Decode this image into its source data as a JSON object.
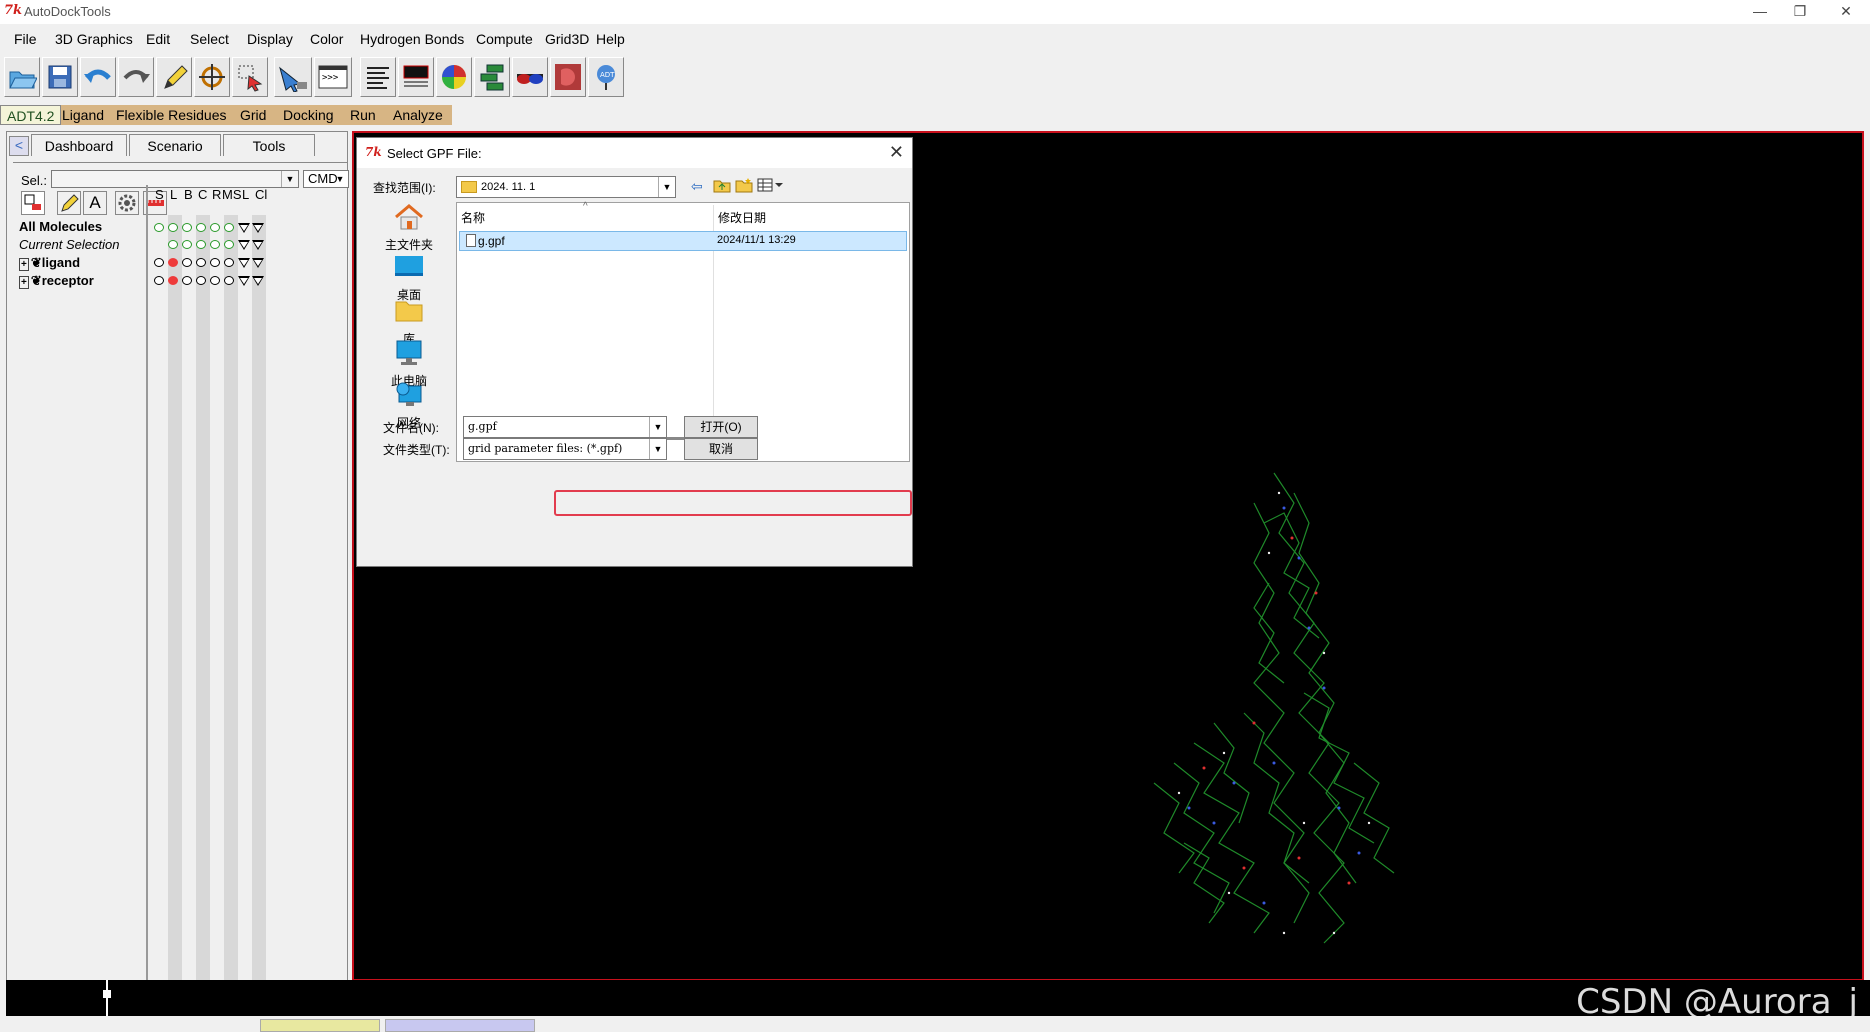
{
  "window": {
    "title": "AutoDockTools",
    "minimize": "—",
    "restore": "❐",
    "close": "✕",
    "app_icon_text": "7k"
  },
  "menu": [
    "File",
    "3D Graphics",
    "Edit",
    "Select",
    "Display",
    "Color",
    "Hydrogen Bonds",
    "Compute",
    "Grid3D",
    "Help"
  ],
  "toolbar_icons": [
    "open-folder-icon",
    "save-icon",
    "undo-icon",
    "redo-icon",
    "pencil-icon",
    "crosshair-icon",
    "select-icon",
    "pick-icon",
    "python-shell-icon",
    "text-editor-icon",
    "command-icon",
    "color-sphere-icon",
    "sequence-icon",
    "stereo-glasses-icon",
    "dejavu-icon",
    "adt-logo-icon"
  ],
  "modules": [
    "ADT4.2",
    "Ligand",
    "Flexible Residues",
    "Grid",
    "Docking",
    "Run",
    "Analyze"
  ],
  "left_panel": {
    "tabs": [
      "Dashboard",
      "Scenario",
      "Tools"
    ],
    "sel_label": "Sel.:",
    "cmd_label": "CMD",
    "columns": [
      "S",
      "L",
      "B",
      "C",
      "R",
      "MS",
      "L",
      "Cl"
    ],
    "rows": {
      "all": "All Molecules",
      "current": "Current Selection",
      "ligand": "ligand",
      "receptor": "receptor"
    }
  },
  "dialog": {
    "title": "Select GPF File:",
    "lookin_label": "查找范围(I):",
    "lookin_value": "2024. 11. 1",
    "places": [
      "主文件夹",
      "桌面",
      "库",
      "此电脑",
      "网络"
    ],
    "col_name": "名称",
    "col_date": "修改日期",
    "file": {
      "name": "g.gpf",
      "date": "2024/11/1 13:29"
    },
    "filename_label": "文件名(N):",
    "filename_value": "g.gpf",
    "filetype_label": "文件类型(T):",
    "filetype_value": "grid parameter files: (*.gpf)",
    "open_button": "打开(O)",
    "cancel_button": "取消"
  },
  "watermark": "CSDN @Aurora_j",
  "colors": {
    "viewer_border": "#c8101c",
    "module_bar": "#d7b584",
    "selected_row": "#cce8ff",
    "highlight": "#e23c4e"
  }
}
